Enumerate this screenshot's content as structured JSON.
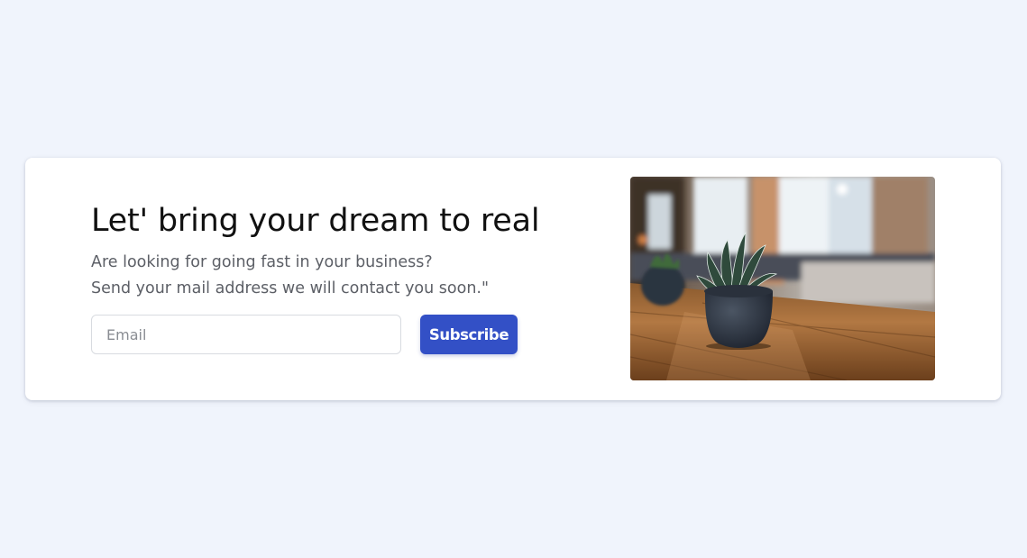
{
  "banner": {
    "title": "Let' bring your dream to real",
    "description_line1": "Are looking for going fast in your business?",
    "description_line2": "Send your mail address we will contact you soon.\"",
    "email_placeholder": "Email",
    "subscribe_label": "Subscribe"
  },
  "colors": {
    "page_background": "#f0f4fc",
    "card_background": "#ffffff",
    "title": "#111111",
    "description": "#5c5f66",
    "button": "#3350c6",
    "button_text": "#ffffff"
  },
  "image": {
    "subject": "potted succulent plants on a wooden table in a blurred office"
  }
}
